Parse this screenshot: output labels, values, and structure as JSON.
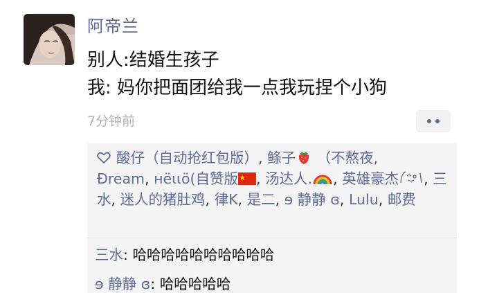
{
  "post": {
    "author": "阿帝兰",
    "lines": [
      "别人:结婚生孩子",
      "我: 妈你把面团给我一点我玩捏个小狗"
    ],
    "time": "7分钟前"
  },
  "likes": {
    "names": [
      "酸仔（自动抢红包版）",
      "鲦子",
      "（不熬夜,",
      "Ɖream",
      "нёɩɩö(自赞版",
      "汤达人.",
      "英雄豪杰",
      "三水",
      "迷人的猪肚鸡",
      "律K",
      "是二",
      "ɘ 静静 ɞ",
      "Lulu",
      "邮费"
    ]
  },
  "comments": [
    {
      "author": "三水",
      "text": "哈哈哈哈哈哈哈哈哈哈"
    },
    {
      "author": "ɘ 静静 ɞ",
      "text": "哈哈哈哈哈"
    }
  ],
  "icons": {
    "like": "heart-icon",
    "more": "more-dots-icon",
    "avatar": "avatar-photo"
  },
  "colors": {
    "link": "#5b6b91",
    "panel": "#f4f4f4",
    "time": "#b4b4b4"
  }
}
